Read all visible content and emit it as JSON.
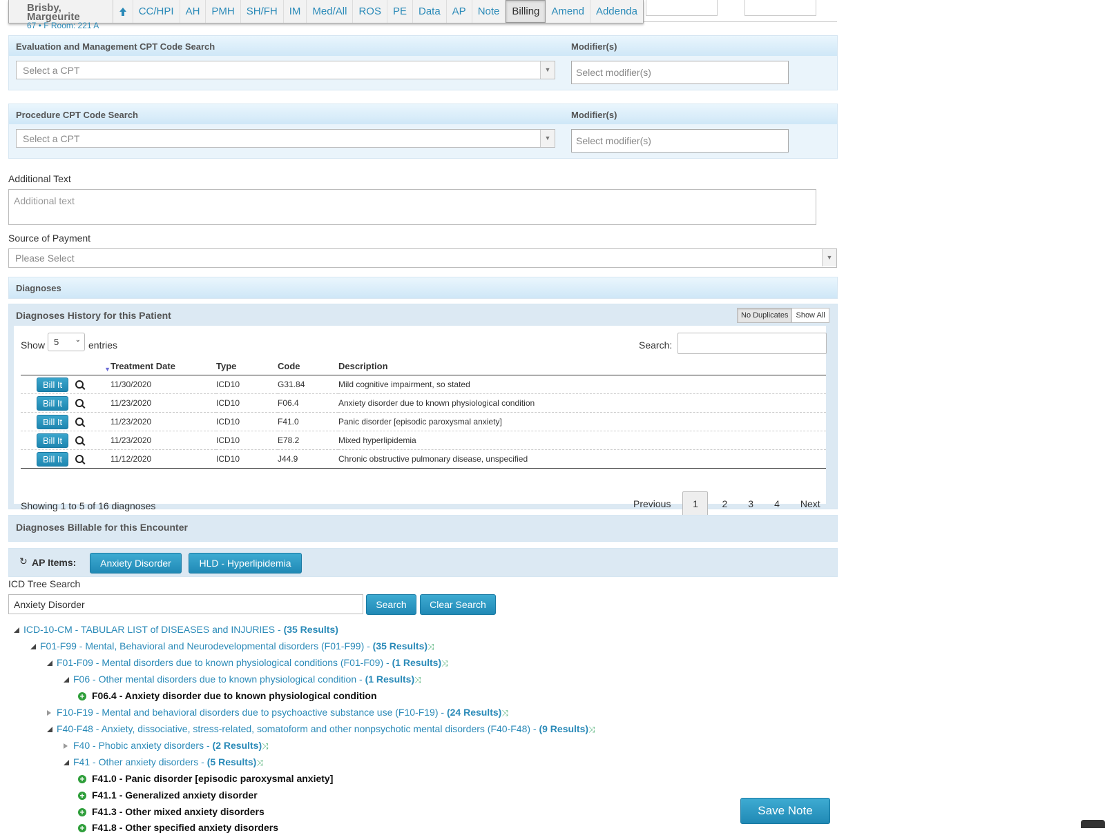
{
  "patient": {
    "name": "Brisby, Margeurite",
    "info": "67 • F   Room: 221 A"
  },
  "nav": [
    "CC/HPI",
    "AH",
    "PMH",
    "SH/FH",
    "IM",
    "Med/All",
    "ROS",
    "PE",
    "Data",
    "AP",
    "Note",
    "Billing",
    "Amend",
    "Addenda"
  ],
  "em": {
    "title": "Evaluation and Management CPT Code Search",
    "placeholder": "Select a CPT",
    "mod_title": "Modifier(s)",
    "mod_placeholder": "Select modifier(s)"
  },
  "proc": {
    "title": "Procedure CPT Code Search",
    "placeholder": "Select a CPT",
    "mod_title": "Modifier(s)",
    "mod_placeholder": "Select modifier(s)"
  },
  "additional": {
    "label": "Additional Text",
    "placeholder": "Additional text"
  },
  "payment": {
    "label": "Source of Payment",
    "placeholder": "Please Select"
  },
  "diagnoses": {
    "title": "Diagnoses"
  },
  "history": {
    "title": "Diagnoses History for this Patient",
    "no_dup": "No Duplicates",
    "show_all": "Show All",
    "show_label": "Show",
    "show_value": "5",
    "entries_label": "entries",
    "search_label": "Search:",
    "columns": [
      "Treatment Date",
      "Type",
      "Code",
      "Description"
    ],
    "bill_label": "Bill It",
    "rows": [
      {
        "date": "11/30/2020",
        "type": "ICD10",
        "code": "G31.84",
        "desc": "Mild cognitive impairment, so stated"
      },
      {
        "date": "11/23/2020",
        "type": "ICD10",
        "code": "F06.4",
        "desc": "Anxiety disorder due to known physiological condition"
      },
      {
        "date": "11/23/2020",
        "type": "ICD10",
        "code": "F41.0",
        "desc": "Panic disorder [episodic paroxysmal anxiety]"
      },
      {
        "date": "11/23/2020",
        "type": "ICD10",
        "code": "E78.2",
        "desc": "Mixed hyperlipidemia"
      },
      {
        "date": "11/12/2020",
        "type": "ICD10",
        "code": "J44.9",
        "desc": "Chronic obstructive pulmonary disease, unspecified"
      }
    ],
    "info": "Showing 1 to 5 of 16 diagnoses",
    "prev": "Previous",
    "next": "Next",
    "pages": [
      "1",
      "2",
      "3",
      "4"
    ]
  },
  "billable": {
    "title": "Diagnoses Billable for this Encounter"
  },
  "ap": {
    "label": "AP Items:",
    "items": [
      "Anxiety Disorder",
      "HLD - Hyperlipidemia"
    ]
  },
  "icd": {
    "label": "ICD Tree Search",
    "value": "Anxiety Disorder",
    "search": "Search",
    "clear": "Clear Search"
  },
  "tree": [
    {
      "text": "ICD-10-CM - TABULAR LIST of DISEASES and INJURIES - ",
      "count": "(35 Results)"
    },
    {
      "text": "F01-F99 - Mental, Behavioral and Neurodevelopmental disorders (F01-F99) - ",
      "count": "(35 Results)"
    },
    {
      "text": "F01-F09 - Mental disorders due to known physiological conditions (F01-F09) - ",
      "count": "(1 Results)"
    },
    {
      "text": "F06 - Other mental disorders due to known physiological condition - ",
      "count": "(1 Results)"
    },
    {
      "text": "F06.4 - Anxiety disorder due to known physiological condition"
    },
    {
      "text": "F10-F19 - Mental and behavioral disorders due to psychoactive substance use (F10-F19) - ",
      "count": "(24 Results)"
    },
    {
      "text": "F40-F48 - Anxiety, dissociative, stress-related, somatoform and other nonpsychotic mental disorders (F40-F48) - ",
      "count": "(9 Results)"
    },
    {
      "text": "F40 - Phobic anxiety disorders - ",
      "count": "(2 Results)"
    },
    {
      "text": "F41 - Other anxiety disorders - ",
      "count": "(5 Results)"
    },
    {
      "text": "F41.0 - Panic disorder [episodic paroxysmal anxiety]"
    },
    {
      "text": "F41.1 - Generalized anxiety disorder"
    },
    {
      "text": "F41.3 - Other mixed anxiety disorders"
    },
    {
      "text": "F41.8 - Other specified anxiety disorders"
    }
  ],
  "save": "Save Note"
}
